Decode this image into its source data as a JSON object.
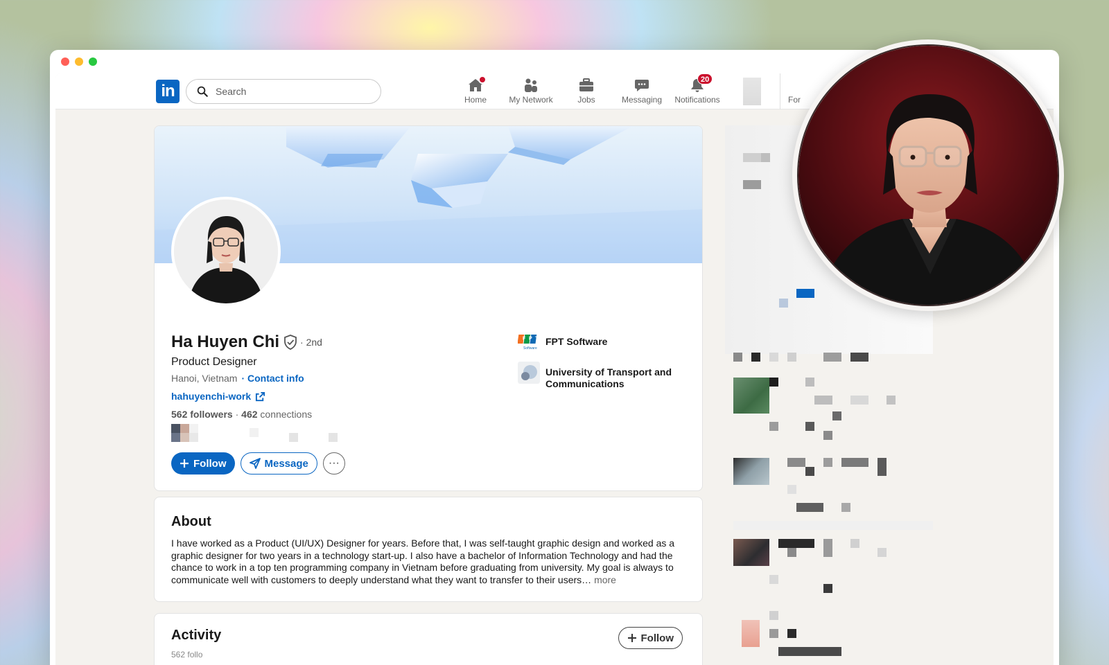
{
  "window": {
    "controls": [
      "close",
      "minimize",
      "zoom"
    ]
  },
  "navbar": {
    "logo_text": "in",
    "search": {
      "placeholder": "Search",
      "value": ""
    },
    "items": [
      {
        "label": "Home",
        "icon": "home-icon",
        "badge": "dot"
      },
      {
        "label": "My Network",
        "icon": "network-icon"
      },
      {
        "label": "Jobs",
        "icon": "briefcase-icon"
      },
      {
        "label": "Messaging",
        "icon": "chat-icon"
      },
      {
        "label": "Notifications",
        "icon": "bell-icon",
        "badge": "20"
      }
    ],
    "partial_label": "For"
  },
  "profile": {
    "name": "Ha Huyen Chi",
    "degree": "· 2nd",
    "headline": "Product Designer",
    "location": "Hanoi, Vietnam",
    "contact_label": "· Contact info",
    "website": "hahuyenchi-work",
    "followers": "562 followers",
    "separator": " · ",
    "connections_count": "462",
    "connections_label": " connections",
    "buttons": {
      "follow": "Follow",
      "message": "Message",
      "more": "···"
    },
    "experience": [
      {
        "name": "FPT Software",
        "logo": "fpt-logo"
      },
      {
        "name": "University of Transport and Communications",
        "logo": "university-logo"
      }
    ]
  },
  "about": {
    "title": "About",
    "text": "I have worked as a Product (UI/UX) Designer for years. Before that, I was self-taught graphic design and worked as a graphic designer for two years in a technology start-up. I also have a bachelor of Information Technology and had the chance to work in a top ten programming company in Vietnam before graduating from university. My goal is always to communicate well with customers to deeply understand what they want to transfer to their users…",
    "more": "more"
  },
  "activity": {
    "title": "Activity",
    "follow_label": "Follow",
    "subtitle": "562 follo"
  },
  "colors": {
    "brand": "#0a66c2",
    "badge": "#cb112d",
    "page_bg": "#f4f2ee"
  }
}
